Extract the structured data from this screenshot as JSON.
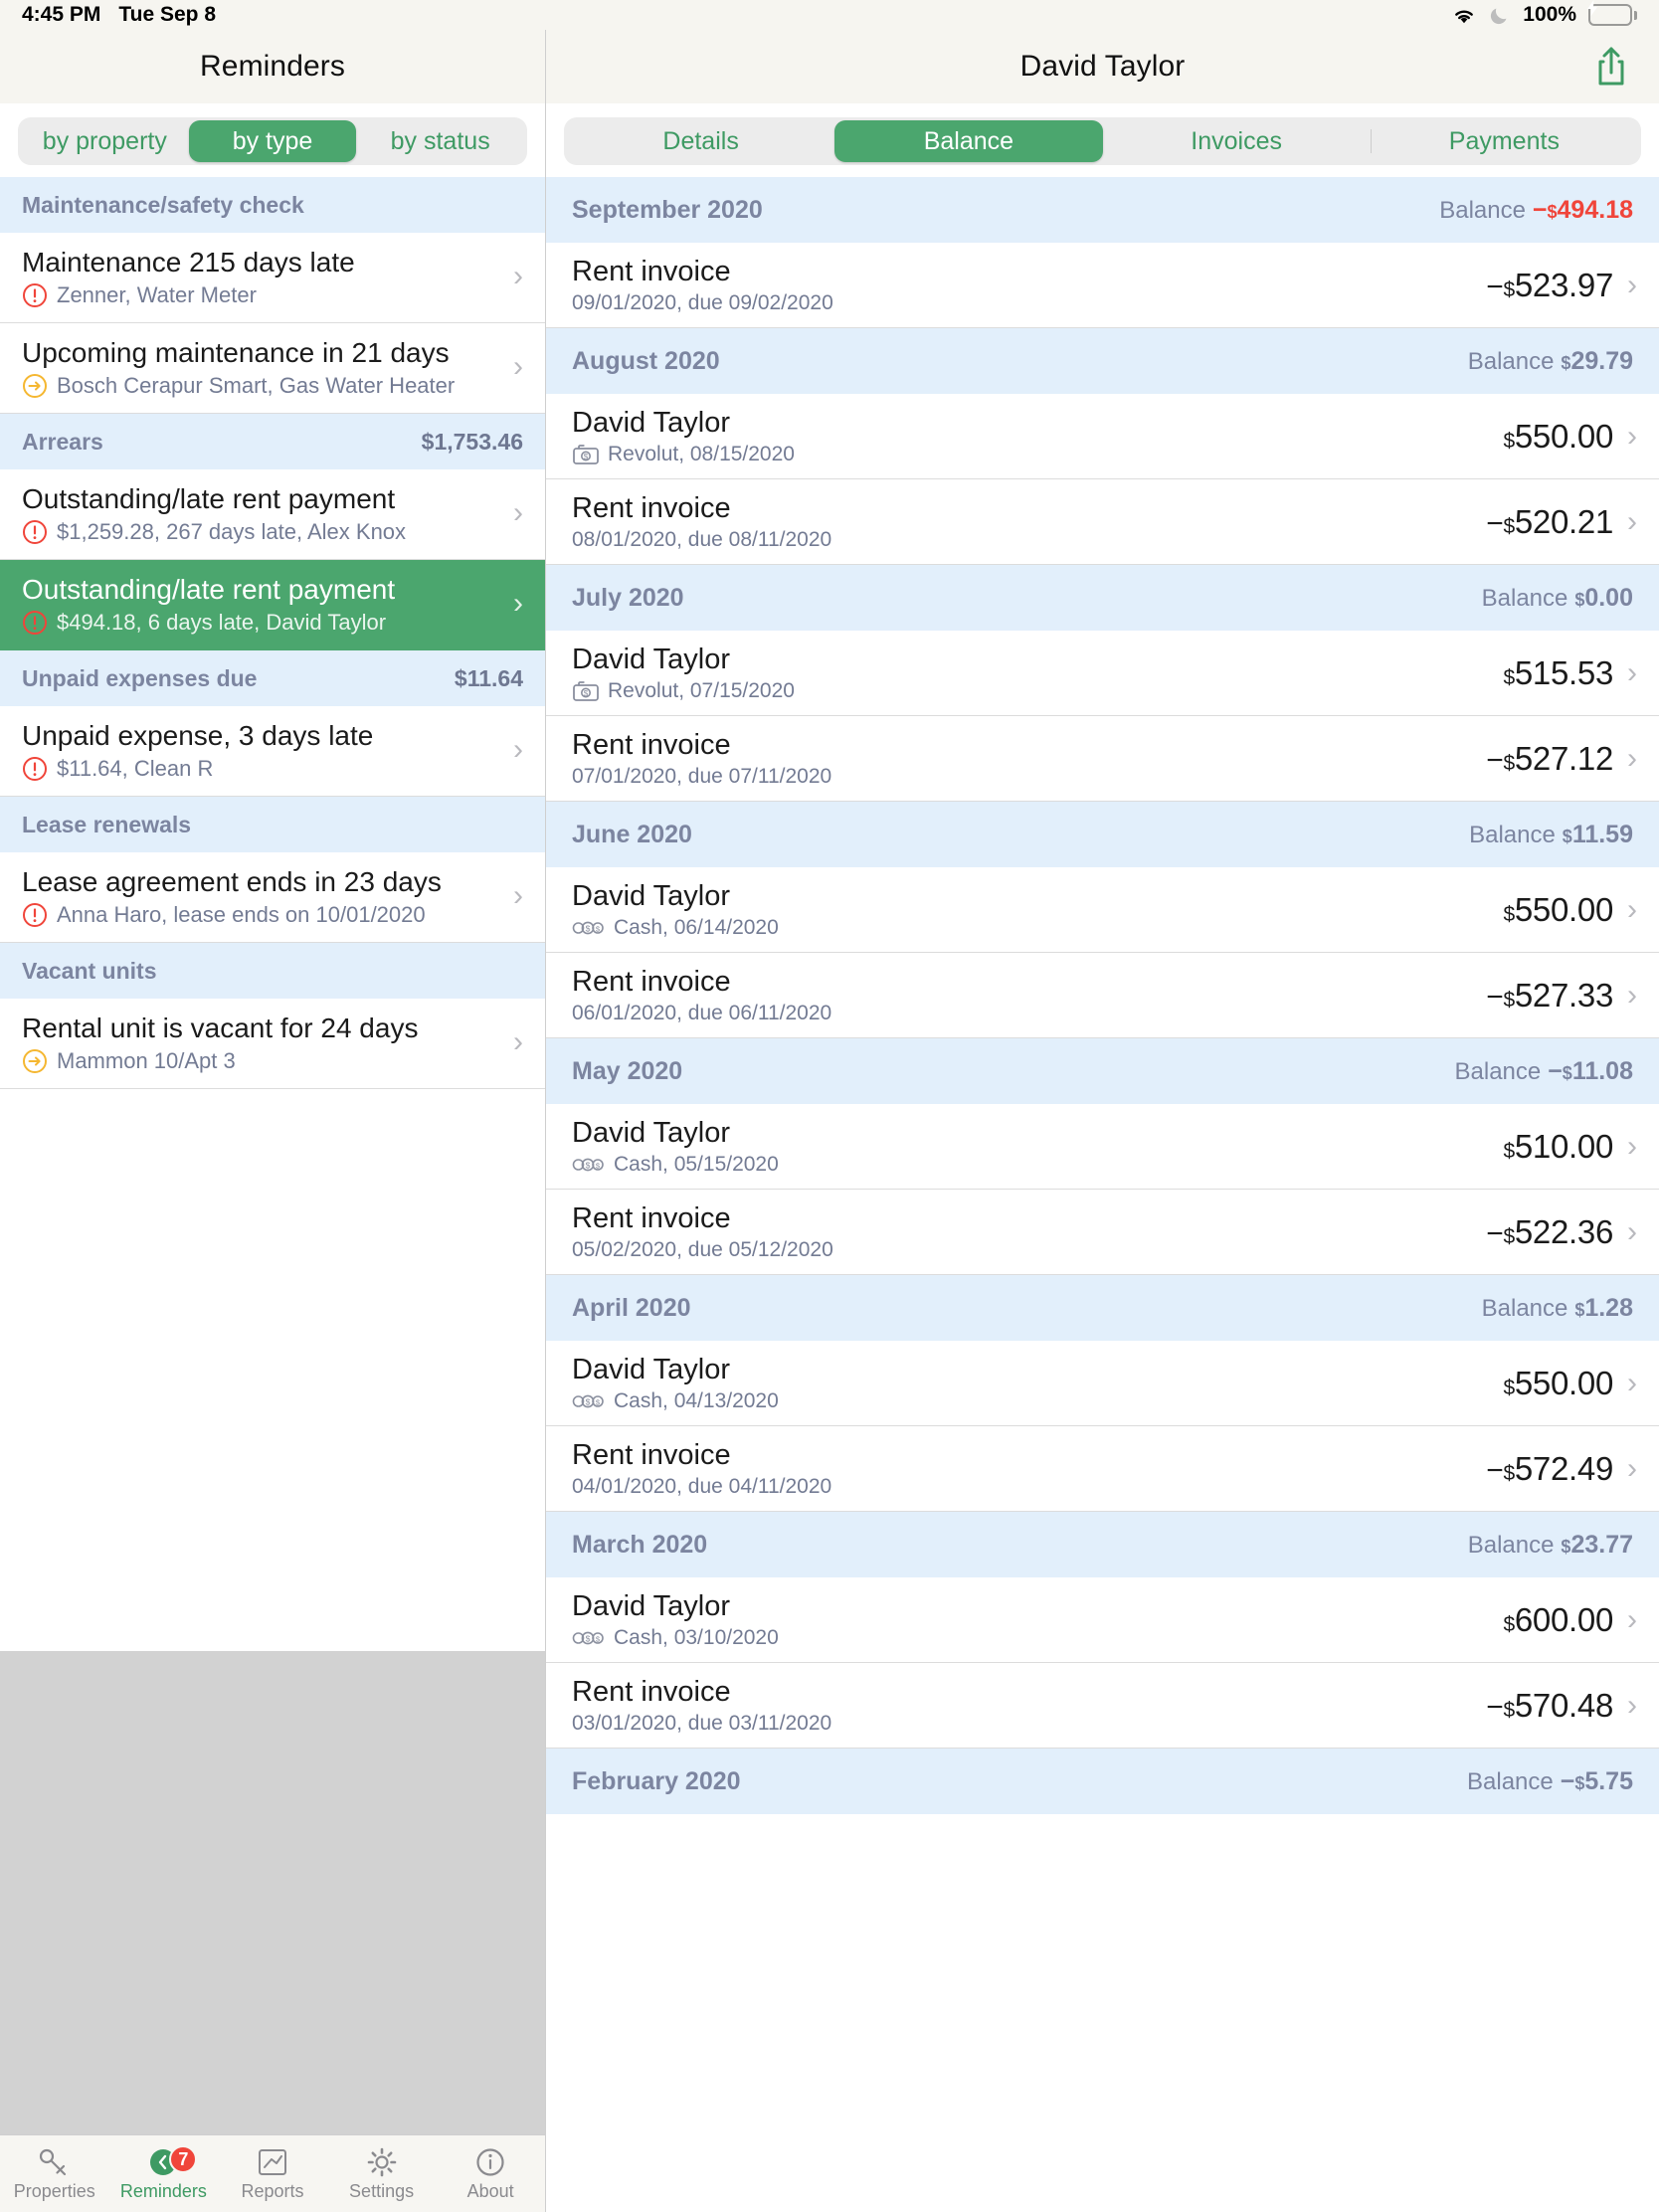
{
  "status_bar": {
    "time": "4:45 PM",
    "date": "Tue Sep 8",
    "battery_percent": "100%",
    "icons": [
      "wifi-icon",
      "moon-icon",
      "battery-charging-icon"
    ]
  },
  "colors": {
    "accent_green": "#4BA66E",
    "section_blue": "#E2EFFB",
    "negative_red": "#F0453A",
    "warning_yellow": "#F5B731",
    "muted_text": "#737B93"
  },
  "left_pane": {
    "title": "Reminders",
    "segmented": {
      "options": [
        "by property",
        "by type",
        "by status"
      ],
      "selected": "by type"
    },
    "sections": [
      {
        "header": "Maintenance/safety check",
        "amount": "",
        "rows": [
          {
            "title": "Maintenance 215 days late",
            "icon": "alert-circle-icon",
            "subtitle": "Zenner, Water Meter",
            "selected": false
          },
          {
            "title": "Upcoming maintenance in 21 days",
            "icon": "arrow-circle-icon",
            "subtitle": "Bosch Cerapur Smart, Gas Water Heater",
            "selected": false
          }
        ]
      },
      {
        "header": "Arrears",
        "amount": "$1,753.46",
        "rows": [
          {
            "title": "Outstanding/late rent payment",
            "icon": "alert-circle-icon",
            "subtitle": "$1,259.28, 267 days late, Alex Knox",
            "selected": false
          },
          {
            "title": "Outstanding/late rent payment",
            "icon": "alert-circle-icon",
            "subtitle": "$494.18, 6 days late, David Taylor",
            "selected": true
          }
        ]
      },
      {
        "header": "Unpaid expenses due",
        "amount": "$11.64",
        "rows": [
          {
            "title": "Unpaid expense, 3 days late",
            "icon": "alert-circle-icon",
            "subtitle": "$11.64, Clean R",
            "selected": false
          }
        ]
      },
      {
        "header": "Lease renewals",
        "amount": "",
        "rows": [
          {
            "title": "Lease agreement ends in 23 days",
            "icon": "alert-circle-icon",
            "subtitle": "Anna Haro, lease ends on 10/01/2020",
            "selected": false
          }
        ]
      },
      {
        "header": "Vacant units",
        "amount": "",
        "rows": [
          {
            "title": "Rental unit is vacant for 24 days",
            "icon": "arrow-circle-icon",
            "subtitle": "Mammon 10/Apt 3",
            "selected": false
          }
        ]
      }
    ]
  },
  "right_pane": {
    "title": "David Taylor",
    "share_icon": "share-icon",
    "tabs": {
      "options": [
        "Details",
        "Balance",
        "Invoices",
        "Payments"
      ],
      "selected": "Balance"
    },
    "months": [
      {
        "month": "September 2020",
        "balance_label": "Balance",
        "balance_value": "494.18",
        "balance_sign": "−",
        "negative": true,
        "entries": [
          {
            "title": "Rent invoice",
            "icon": "",
            "subtitle": "09/01/2020, due 09/02/2020",
            "sign": "−",
            "amount": "523.97",
            "chevron": true
          }
        ]
      },
      {
        "month": "August 2020",
        "balance_label": "Balance",
        "balance_value": "29.79",
        "balance_sign": "",
        "negative": false,
        "entries": [
          {
            "title": "David Taylor",
            "icon": "bank-icon",
            "subtitle": "Revolut, 08/15/2020",
            "sign": "",
            "amount": "550.00",
            "chevron": true
          },
          {
            "title": "Rent invoice",
            "icon": "",
            "subtitle": "08/01/2020, due 08/11/2020",
            "sign": "−",
            "amount": "520.21",
            "chevron": true
          }
        ]
      },
      {
        "month": "July 2020",
        "balance_label": "Balance",
        "balance_value": "0.00",
        "balance_sign": "",
        "negative": false,
        "entries": [
          {
            "title": "David Taylor",
            "icon": "bank-icon",
            "subtitle": "Revolut, 07/15/2020",
            "sign": "",
            "amount": "515.53",
            "chevron": true
          },
          {
            "title": "Rent invoice",
            "icon": "",
            "subtitle": "07/01/2020, due 07/11/2020",
            "sign": "−",
            "amount": "527.12",
            "chevron": true
          }
        ]
      },
      {
        "month": "June 2020",
        "balance_label": "Balance",
        "balance_value": "11.59",
        "balance_sign": "",
        "negative": false,
        "entries": [
          {
            "title": "David Taylor",
            "icon": "cash-icon",
            "subtitle": "Cash, 06/14/2020",
            "sign": "",
            "amount": "550.00",
            "chevron": true
          },
          {
            "title": "Rent invoice",
            "icon": "",
            "subtitle": "06/01/2020, due 06/11/2020",
            "sign": "−",
            "amount": "527.33",
            "chevron": true
          }
        ]
      },
      {
        "month": "May 2020",
        "balance_label": "Balance",
        "balance_value": "11.08",
        "balance_sign": "−",
        "negative": false,
        "entries": [
          {
            "title": "David Taylor",
            "icon": "cash-icon",
            "subtitle": "Cash, 05/15/2020",
            "sign": "",
            "amount": "510.00",
            "chevron": true
          },
          {
            "title": "Rent invoice",
            "icon": "",
            "subtitle": "05/02/2020, due 05/12/2020",
            "sign": "−",
            "amount": "522.36",
            "chevron": true
          }
        ]
      },
      {
        "month": "April 2020",
        "balance_label": "Balance",
        "balance_value": "1.28",
        "balance_sign": "",
        "negative": false,
        "entries": [
          {
            "title": "David Taylor",
            "icon": "cash-icon",
            "subtitle": "Cash, 04/13/2020",
            "sign": "",
            "amount": "550.00",
            "chevron": true
          },
          {
            "title": "Rent invoice",
            "icon": "",
            "subtitle": "04/01/2020, due 04/11/2020",
            "sign": "−",
            "amount": "572.49",
            "chevron": true
          }
        ]
      },
      {
        "month": "March 2020",
        "balance_label": "Balance",
        "balance_value": "23.77",
        "balance_sign": "",
        "negative": false,
        "entries": [
          {
            "title": "David Taylor",
            "icon": "cash-icon",
            "subtitle": "Cash, 03/10/2020",
            "sign": "",
            "amount": "600.00",
            "chevron": true
          },
          {
            "title": "Rent invoice",
            "icon": "",
            "subtitle": "03/01/2020, due 03/11/2020",
            "sign": "−",
            "amount": "570.48",
            "chevron": true
          }
        ]
      },
      {
        "month": "February 2020",
        "balance_label": "Balance",
        "balance_value": "5.75",
        "balance_sign": "−",
        "negative": false,
        "entries": []
      }
    ]
  },
  "tab_bar": {
    "items": [
      {
        "label": "Properties",
        "icon": "key-icon",
        "active": false,
        "badge": ""
      },
      {
        "label": "Reminders",
        "icon": "bell-icon",
        "active": true,
        "badge": "7"
      },
      {
        "label": "Reports",
        "icon": "chart-icon",
        "active": false,
        "badge": ""
      },
      {
        "label": "Settings",
        "icon": "gear-icon",
        "active": false,
        "badge": ""
      },
      {
        "label": "About",
        "icon": "info-icon",
        "active": false,
        "badge": ""
      }
    ]
  }
}
